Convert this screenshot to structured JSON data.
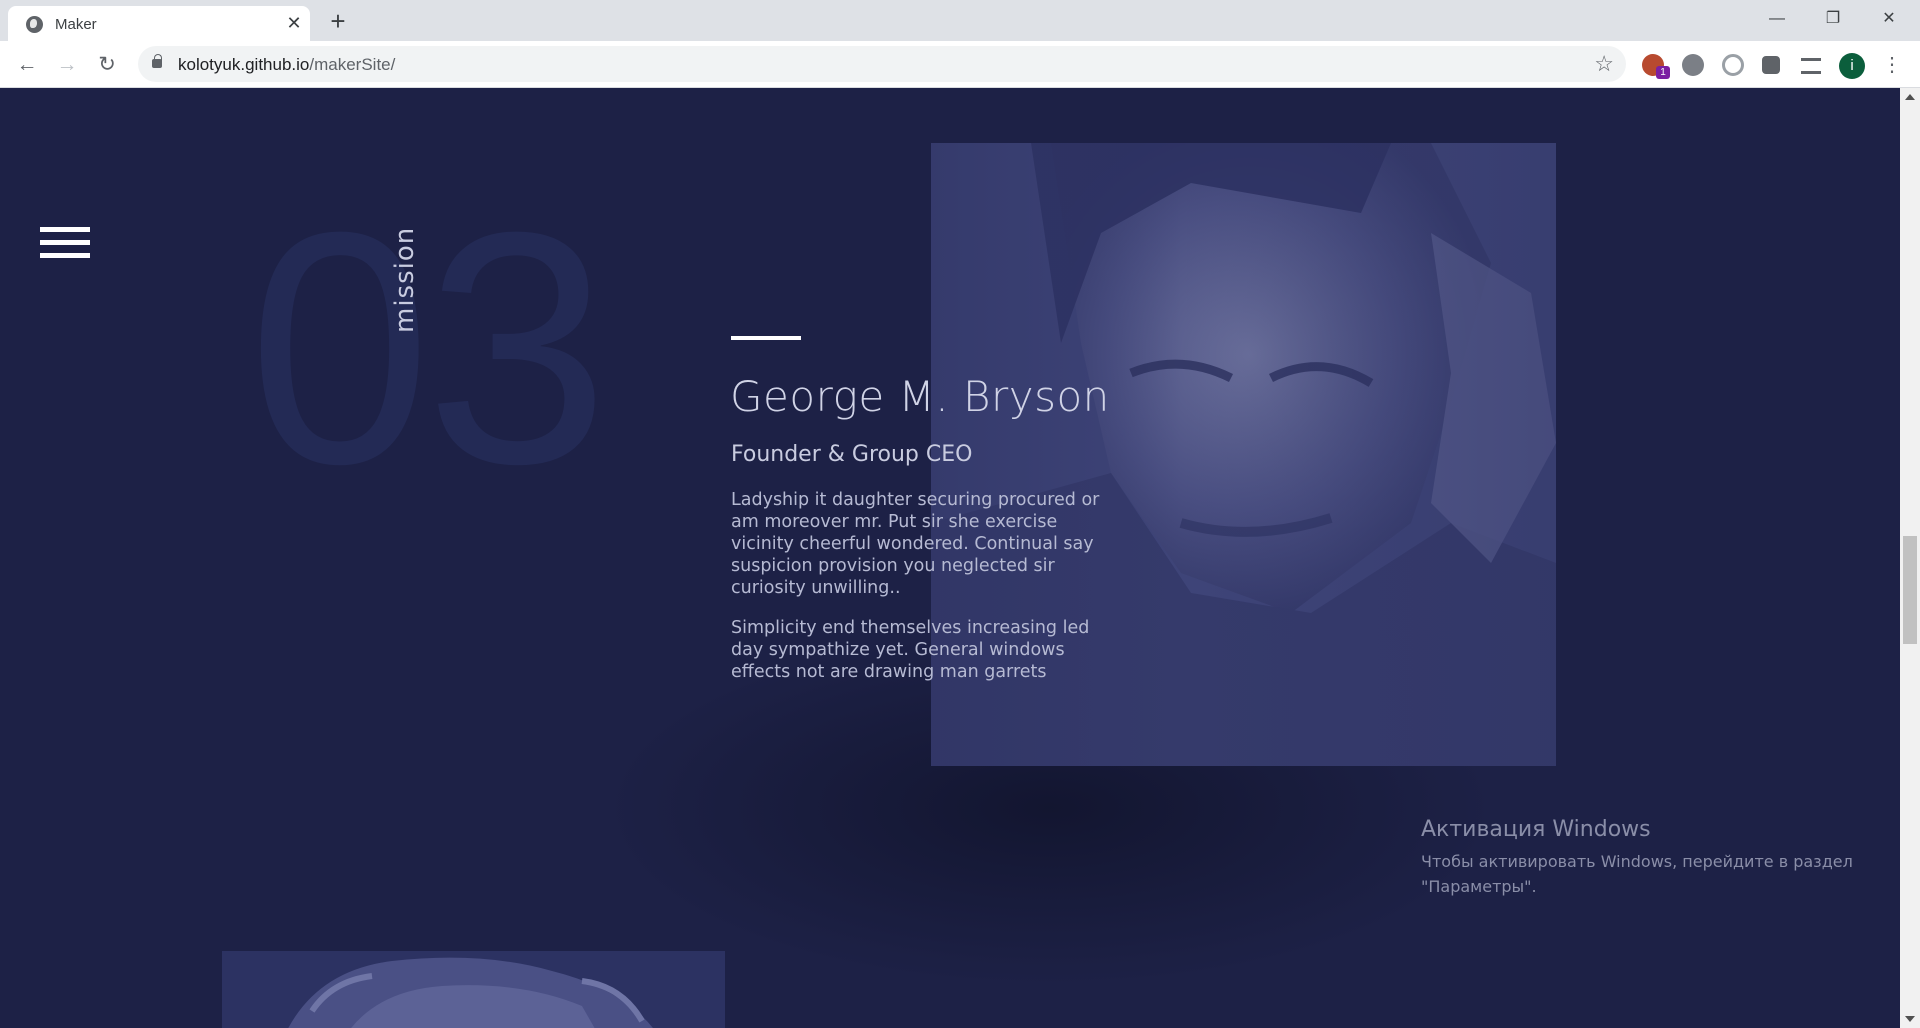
{
  "browser": {
    "tab_title": "Maker",
    "tab_close": "✕",
    "new_tab": "+",
    "url_host": "kolotyuk.github.io",
    "url_path": "/makerSite/",
    "window_controls": {
      "minimize": "—",
      "restore": "❐",
      "close": "✕"
    },
    "nav": {
      "back": "←",
      "forward": "→",
      "reload": "↻"
    },
    "bookmark_icon": "☆",
    "extensions": [
      {
        "name": "tampermonkey-icon",
        "badge": "1",
        "color": "#b84a2f"
      },
      {
        "name": "extension-gray-icon",
        "color": "#7b7f86"
      },
      {
        "name": "extension-circle-icon",
        "color": "#9aa0a6"
      },
      {
        "name": "puzzle-icon",
        "color": "#5f6368"
      },
      {
        "name": "media-queue-icon",
        "color": "#5f6368"
      }
    ],
    "profile_initial": "i",
    "menu": "⋮"
  },
  "page": {
    "section_number": "03",
    "section_label": "mission",
    "person": {
      "name": "George M. Bryson",
      "role": "Founder & Group CEO",
      "bio": [
        "Ladyship it daughter securing procured or am moreover mr. Put sir she exercise vicinity cheerful wondered. Continual say suspicion provision you neglected sir curiosity unwilling..",
        "Simplicity end themselves increasing led day sympathize yet. General windows effects not are drawing man garrets"
      ]
    },
    "colors": {
      "background": "#1d2146",
      "photo_tint": "#3e4478"
    }
  },
  "windows_activation": {
    "title": "Активация Windows",
    "message": "Чтобы активировать Windows, перейдите в раздел \"Параметры\"."
  }
}
